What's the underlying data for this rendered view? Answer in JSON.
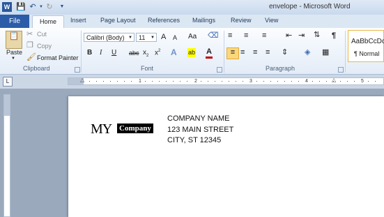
{
  "title_bar": {
    "title": "envelope - Microsoft Word",
    "app_icon": "W"
  },
  "quick_access": [
    "save-icon",
    "undo-icon",
    "redo-icon",
    "customize-icon"
  ],
  "tabs": {
    "file": "File",
    "home": "Home",
    "items": [
      "Insert",
      "Page Layout",
      "References",
      "Mailings",
      "Review",
      "View"
    ]
  },
  "clipboard": {
    "paste": "Paste",
    "cut": "Cut",
    "copy": "Copy",
    "format_painter": "Format Painter",
    "group": "Clipboard"
  },
  "font": {
    "name": "Calibri (Body)",
    "size": "11",
    "grow": "A",
    "shrink": "A",
    "change_case": "Aa",
    "bold": "B",
    "italic": "I",
    "underline": "U",
    "strike": "abc",
    "subscript": "x",
    "superscript": "x",
    "group": "Font"
  },
  "paragraph": {
    "group": "Paragraph",
    "pilcrow": "¶"
  },
  "styles": {
    "preview": "AaBbCcDc",
    "normal": "¶ Normal"
  },
  "ruler": {
    "numbers": [
      "1",
      "2",
      "3",
      "4",
      "5"
    ],
    "corner": "L"
  },
  "document": {
    "logo_my": "MY",
    "logo_company": "Company",
    "address": [
      "COMPANY NAME",
      "123 MAIN STREET",
      "CITY, ST 12345"
    ]
  },
  "colors": {
    "file_tab": "#2a5ca8",
    "ribbon": "#e3ecf7",
    "highlight": "#ffff00",
    "font_color": "#c00000"
  }
}
